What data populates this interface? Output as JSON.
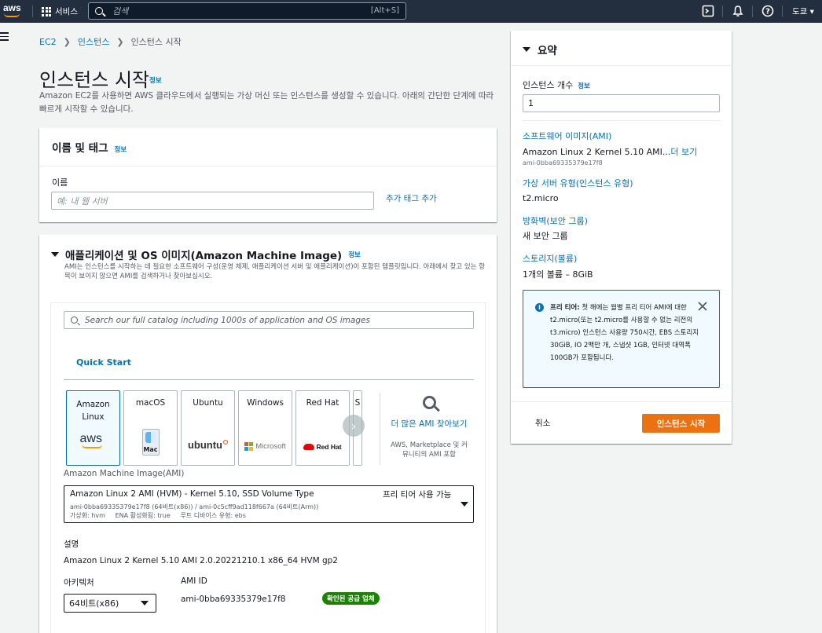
{
  "topnav": {
    "logo_text": "aws",
    "services_label": "서비스",
    "search_placeholder": "검색",
    "search_shortcut": "[Alt+S]",
    "region_label": "도쿄 ▾"
  },
  "breadcrumb": {
    "items": [
      "EC2",
      "인스턴스",
      "인스턴스 시작"
    ]
  },
  "page": {
    "title": "인스턴스 시작",
    "info_label": "정보",
    "description": "Amazon EC2를 사용하면 AWS 클라우드에서 실행되는 가상 머신 또는 인스턴스를 생성할 수 있습니다. 아래의 간단한 단계에 따라 빠르게 시작할 수 있습니다."
  },
  "name_section": {
    "title": "이름 및 태그",
    "info_label": "정보",
    "name_label": "이름",
    "name_placeholder": "예: 내 웹 서버",
    "add_tag_link": "추가 태그 추가"
  },
  "ami_section": {
    "title": "애플리케이션 및 OS 이미지(Amazon Machine Image)",
    "info_label": "정보",
    "description": "AMI는 인스턴스를 시작하는 데 필요한 소프트웨어 구성(운영 체제, 애플리케이션 서버 및 애플리케이션)이 포함된 템플릿입니다. 아래에서 찾고 있는 항목이 보이지 않으면 AMI를 검색하거나 찾아보십시오.",
    "search_placeholder": "Search our full catalog including 1000s of application and OS images",
    "quick_start_tab": "Quick Start",
    "os_tiles": [
      {
        "label": "Amazon\nLinux",
        "logo": "aws",
        "selected": true
      },
      {
        "label": "macOS",
        "logo": "Mac",
        "selected": false
      },
      {
        "label": "Ubuntu",
        "logo": "ubuntu",
        "selected": false
      },
      {
        "label": "Windows",
        "logo": "Microsoft",
        "selected": false
      },
      {
        "label": "Red Hat",
        "logo": "Red Hat",
        "selected": false
      },
      {
        "label": "S",
        "logo": "",
        "selected": false
      }
    ],
    "more_ami_link": "더 많은 AMI 찾아보기",
    "more_ami_note": "AWS, Marketplace 및 커뮤니티의 AMI 포함",
    "ami_field_label": "Amazon Machine Image(AMI)",
    "selected_ami": {
      "name": "Amazon Linux 2 AMI (HVM) - Kernel 5.10, SSD Volume Type",
      "free_tier": "프리 티어 사용 가능",
      "ids": "ami-0bba69335379e17f8 (64비트(x86)) / ami-0c5cff9ad118f667a (64비트(Arm))",
      "meta": "가상화: hvm     ENA 활성화됨: true     루트 디바이스 유형: ebs"
    },
    "description_label": "설명",
    "description_value": "Amazon Linux 2 Kernel 5.10 AMI 2.0.20221210.1 x86_64 HVM gp2",
    "arch_label": "아키텍처",
    "arch_value": "64비트(x86)",
    "ami_id_label": "AMI ID",
    "ami_id_value": "ami-0bba69335379e17f8",
    "verified_badge": "확인된 공급 업체"
  },
  "summary": {
    "title": "요약",
    "instance_count_label": "인스턴스 개수",
    "info_label": "정보",
    "instance_count_value": "1",
    "software_image_label": "소프트웨어 이미지(AMI)",
    "software_image_value": "Amazon Linux 2 Kernel 5.10 AMI...",
    "more_link": "더 보기",
    "software_image_id": "ami-0bba69335379e17f8",
    "instance_type_label": "가상 서버 유형(인스턴스 유형)",
    "instance_type_value": "t2.micro",
    "firewall_label": "방화벽(보안 그룹)",
    "firewall_value": "새 보안 그룹",
    "storage_label": "스토리지(볼륨)",
    "storage_value": "1개의 볼륨 – 8GiB",
    "free_tier_title": "프리 티어:",
    "free_tier_text": "첫 해에는 월별 프리 티어 AMI에 대한 t2.micro(또는 t2.micro를 사용할 수 없는 리전의 t3.micro) 인스턴스 사용량 750시간, EBS 스토리지 30GiB, IO 2백만 개, 스냅샷 1GB, 인터넷 대역폭 100GB가 포함됩니다.",
    "cancel_label": "취소",
    "launch_label": "인스턴스 시작"
  },
  "colors": {
    "nav_bg": "#232f3e",
    "link": "#0073bb",
    "primary_button": "#ec7211",
    "success_badge": "#1d8102"
  }
}
